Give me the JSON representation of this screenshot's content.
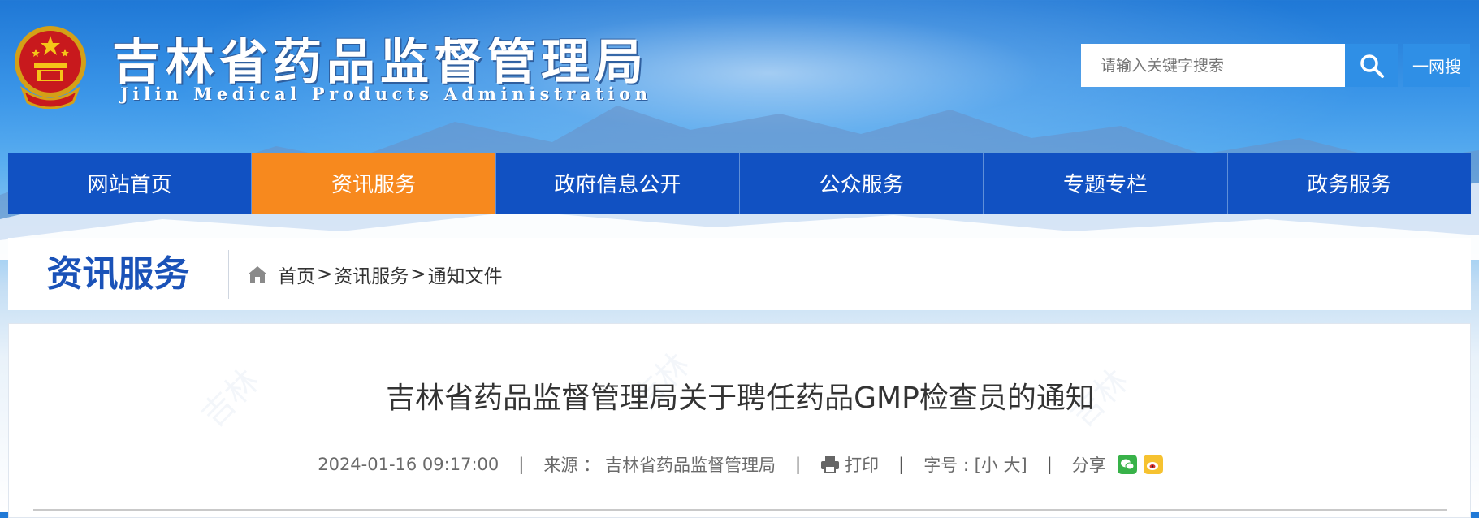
{
  "header": {
    "title_cn": "吉林省药品监督管理局",
    "title_en": "Jilin Medical Products Administration",
    "search_placeholder": "请输入关键字搜索",
    "search_icon": "search-icon",
    "yiwang_label": "一网搜"
  },
  "nav": {
    "items": [
      {
        "label": "网站首页"
      },
      {
        "label": "资讯服务"
      },
      {
        "label": "政府信息公开"
      },
      {
        "label": "公众服务"
      },
      {
        "label": "专题专栏"
      },
      {
        "label": "政务服务"
      }
    ],
    "active_index": 1
  },
  "breadcrumb": {
    "section_title": "资讯服务",
    "items": [
      "首页",
      "资讯服务",
      "通知文件"
    ],
    "separator": ">"
  },
  "article": {
    "title": "吉林省药品监督管理局关于聘任药品GMP检查员的通知",
    "datetime": "2024-01-16 09:17:00",
    "source_label": "来源 ：",
    "source": "吉林省药品监督管理局",
    "print_label": "打印",
    "font_size_label": "字号 : [小 大]",
    "share_label": "分享"
  },
  "colors": {
    "nav_bg": "#1151c2",
    "nav_active": "#f7891e",
    "search_button": "#2f8fe6",
    "section_title": "#1a52b8",
    "wechat": "#38b249",
    "weibo": "#f6c230"
  }
}
